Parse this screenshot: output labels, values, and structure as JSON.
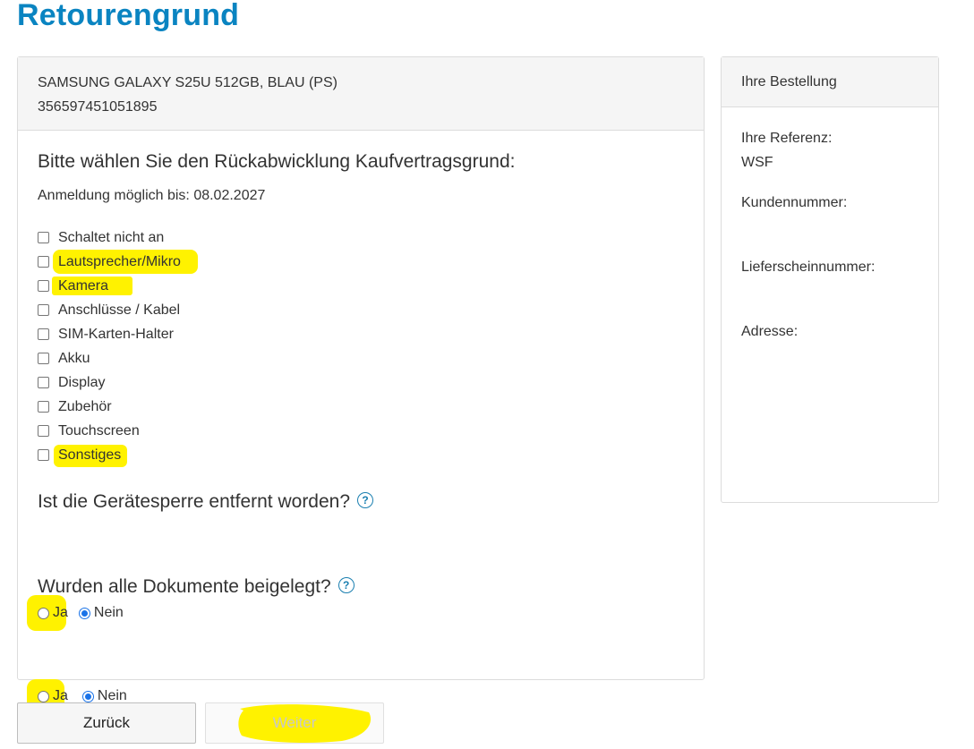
{
  "page": {
    "title": "Retourengrund"
  },
  "product": {
    "name": "SAMSUNG GALAXY S25U 512GB, BLAU (PS)",
    "imei": "356597451051895"
  },
  "reason_section": {
    "question": "Bitte wählen Sie den Rückabwicklung Kaufvertragsgrund:",
    "deadline": "Anmeldung möglich bis: 08.02.2027",
    "options": [
      {
        "label": "Schaltet nicht an",
        "checked": false,
        "highlighted": false
      },
      {
        "label": "Lautsprecher/Mikro",
        "checked": false,
        "highlighted": true
      },
      {
        "label": "Kamera",
        "checked": false,
        "highlighted": true
      },
      {
        "label": "Anschlüsse / Kabel",
        "checked": false,
        "highlighted": false
      },
      {
        "label": "SIM-Karten-Halter",
        "checked": false,
        "highlighted": false
      },
      {
        "label": "Akku",
        "checked": false,
        "highlighted": false
      },
      {
        "label": "Display",
        "checked": false,
        "highlighted": false
      },
      {
        "label": "Zubehör",
        "checked": false,
        "highlighted": false
      },
      {
        "label": "Touchscreen",
        "checked": false,
        "highlighted": false
      },
      {
        "label": "Sonstiges",
        "checked": false,
        "highlighted": true
      }
    ]
  },
  "lock_question": {
    "question": "Ist die Gerätesperre entfernt worden?",
    "help_icon": "?",
    "yes": "Ja",
    "no": "Nein",
    "selected": "Nein"
  },
  "docs_question": {
    "question": "Wurden alle Dokumente beigelegt?",
    "help_icon": "?",
    "yes": "Ja",
    "no": "Nein",
    "selected": "Nein"
  },
  "order_panel": {
    "title": "Ihre Bestellung",
    "reference_label": "Ihre Referenz:",
    "reference_value": "WSF",
    "customer_number_label": "Kundennummer:",
    "delivery_note_label": "Lieferscheinnummer:",
    "address_label": "Adresse:"
  },
  "buttons": {
    "back": "Zurück",
    "next": "Weiter"
  },
  "colors": {
    "title_blue": "#0a84c1",
    "highlight_yellow": "#fff200",
    "radio_blue": "#1a73e8"
  }
}
